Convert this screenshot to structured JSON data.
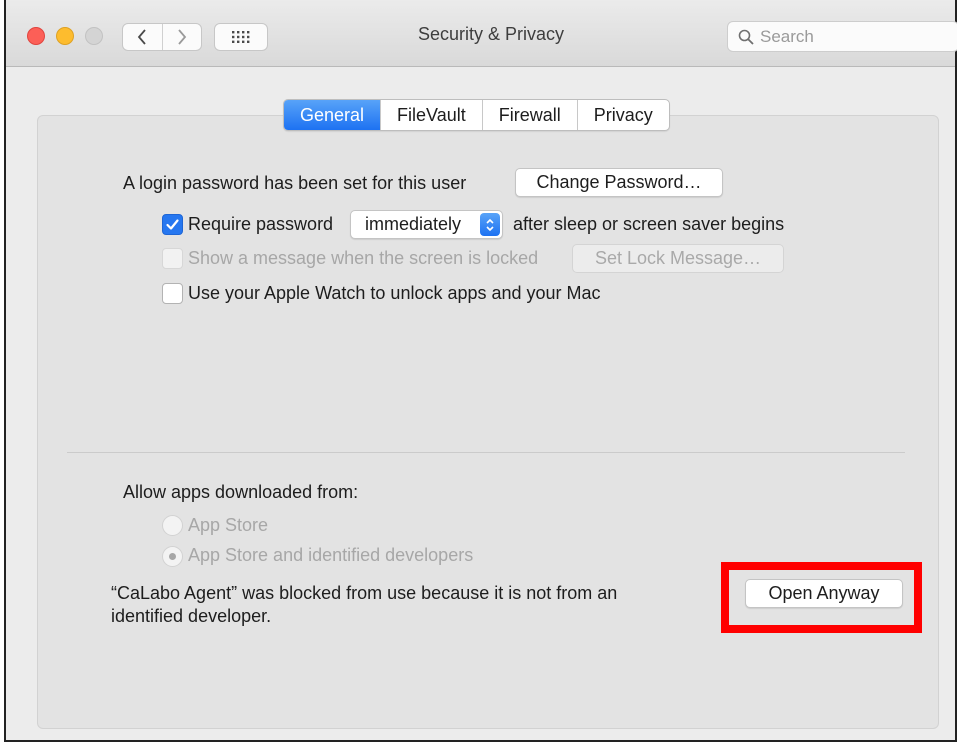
{
  "window": {
    "title": "Security & Privacy",
    "controls": [
      "close",
      "minimize",
      "zoom"
    ],
    "nav": {
      "back_icon": "chevron-left-icon",
      "forward_icon": "chevron-right-icon",
      "show_all_icon": "grid-icon"
    },
    "search": {
      "placeholder": "Search",
      "value": ""
    }
  },
  "tabs": [
    {
      "label": "General",
      "active": true
    },
    {
      "label": "FileVault",
      "active": false
    },
    {
      "label": "Firewall",
      "active": false
    },
    {
      "label": "Privacy",
      "active": false
    }
  ],
  "general": {
    "login_password_text": "A login password has been set for this user",
    "change_password_label": "Change Password…",
    "require_password": {
      "checked": true,
      "label": "Require password",
      "select_value": "immediately",
      "suffix": "after sleep or screen saver begins"
    },
    "lock_message": {
      "checked": false,
      "enabled": false,
      "label": "Show a message when the screen is locked",
      "button_label": "Set Lock Message…"
    },
    "apple_watch": {
      "checked": false,
      "label": "Use your Apple Watch to unlock apps and your Mac"
    }
  },
  "allow_apps": {
    "heading": "Allow apps downloaded from:",
    "options": [
      {
        "label": "App Store",
        "selected": false,
        "enabled": false
      },
      {
        "label": "App Store and identified developers",
        "selected": true,
        "enabled": false
      }
    ],
    "blocked_line1": "“CaLabo Agent” was blocked from use because it is not from an",
    "blocked_line2": "identified developer.",
    "open_anyway_label": "Open Anyway"
  },
  "colors": {
    "accent": "#1d72f2",
    "highlight_box": "#ff0000",
    "close": "#fc5f57",
    "minimize": "#fdbc2e"
  }
}
